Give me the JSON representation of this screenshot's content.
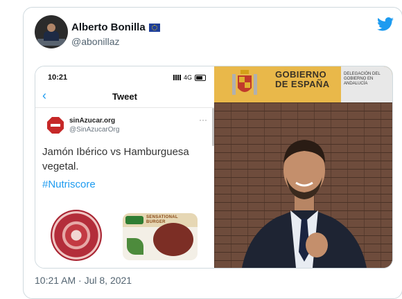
{
  "tweet": {
    "author_name": "Alberto Bonilla",
    "author_handle": "@abonillaz",
    "timestamp": "10:21 AM · Jul 8, 2021"
  },
  "embedded_screenshot": {
    "status_time": "10:21",
    "network": "4G",
    "header_title": "Tweet",
    "back_glyph": "‹",
    "quoted_name": "sinAzucar.org",
    "quoted_handle": "@SinAzucarOrg",
    "more_glyph": "···",
    "text": "Jamón Ibérico vs Hamburguesa vegetal.",
    "hashtag": "#Nutriscore",
    "package_label": "SENSATIONAL BURGER"
  },
  "photo": {
    "banner_text": "GOBIERNO DE ESPAÑA",
    "banner_text_line1": "GOBIERNO",
    "banner_text_line2": "DE ESPAÑA",
    "delegation_text": "DELEGACIÓN DEL GOBIERNO EN ANDALUCÍA"
  },
  "colors": {
    "twitter_blue": "#1d9bf0",
    "text_dark": "#0f1419",
    "text_muted": "#536471"
  },
  "icons": [
    "twitter-bird-icon",
    "eu-flag-icon",
    "back-chevron-icon",
    "signal-icon",
    "battery-icon"
  ]
}
